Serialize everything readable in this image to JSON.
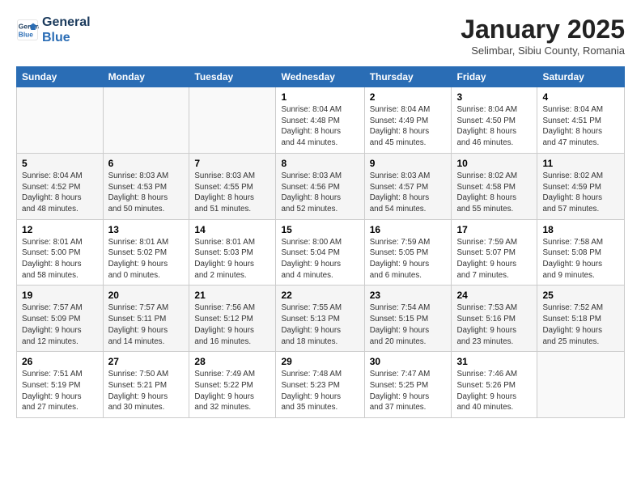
{
  "logo": {
    "line1": "General",
    "line2": "Blue"
  },
  "title": "January 2025",
  "subtitle": "Selimbar, Sibiu County, Romania",
  "headers": [
    "Sunday",
    "Monday",
    "Tuesday",
    "Wednesday",
    "Thursday",
    "Friday",
    "Saturday"
  ],
  "weeks": [
    [
      {
        "num": "",
        "info": ""
      },
      {
        "num": "",
        "info": ""
      },
      {
        "num": "",
        "info": ""
      },
      {
        "num": "1",
        "info": "Sunrise: 8:04 AM\nSunset: 4:48 PM\nDaylight: 8 hours\nand 44 minutes."
      },
      {
        "num": "2",
        "info": "Sunrise: 8:04 AM\nSunset: 4:49 PM\nDaylight: 8 hours\nand 45 minutes."
      },
      {
        "num": "3",
        "info": "Sunrise: 8:04 AM\nSunset: 4:50 PM\nDaylight: 8 hours\nand 46 minutes."
      },
      {
        "num": "4",
        "info": "Sunrise: 8:04 AM\nSunset: 4:51 PM\nDaylight: 8 hours\nand 47 minutes."
      }
    ],
    [
      {
        "num": "5",
        "info": "Sunrise: 8:04 AM\nSunset: 4:52 PM\nDaylight: 8 hours\nand 48 minutes."
      },
      {
        "num": "6",
        "info": "Sunrise: 8:03 AM\nSunset: 4:53 PM\nDaylight: 8 hours\nand 50 minutes."
      },
      {
        "num": "7",
        "info": "Sunrise: 8:03 AM\nSunset: 4:55 PM\nDaylight: 8 hours\nand 51 minutes."
      },
      {
        "num": "8",
        "info": "Sunrise: 8:03 AM\nSunset: 4:56 PM\nDaylight: 8 hours\nand 52 minutes."
      },
      {
        "num": "9",
        "info": "Sunrise: 8:03 AM\nSunset: 4:57 PM\nDaylight: 8 hours\nand 54 minutes."
      },
      {
        "num": "10",
        "info": "Sunrise: 8:02 AM\nSunset: 4:58 PM\nDaylight: 8 hours\nand 55 minutes."
      },
      {
        "num": "11",
        "info": "Sunrise: 8:02 AM\nSunset: 4:59 PM\nDaylight: 8 hours\nand 57 minutes."
      }
    ],
    [
      {
        "num": "12",
        "info": "Sunrise: 8:01 AM\nSunset: 5:00 PM\nDaylight: 8 hours\nand 58 minutes."
      },
      {
        "num": "13",
        "info": "Sunrise: 8:01 AM\nSunset: 5:02 PM\nDaylight: 9 hours\nand 0 minutes."
      },
      {
        "num": "14",
        "info": "Sunrise: 8:01 AM\nSunset: 5:03 PM\nDaylight: 9 hours\nand 2 minutes."
      },
      {
        "num": "15",
        "info": "Sunrise: 8:00 AM\nSunset: 5:04 PM\nDaylight: 9 hours\nand 4 minutes."
      },
      {
        "num": "16",
        "info": "Sunrise: 7:59 AM\nSunset: 5:05 PM\nDaylight: 9 hours\nand 6 minutes."
      },
      {
        "num": "17",
        "info": "Sunrise: 7:59 AM\nSunset: 5:07 PM\nDaylight: 9 hours\nand 7 minutes."
      },
      {
        "num": "18",
        "info": "Sunrise: 7:58 AM\nSunset: 5:08 PM\nDaylight: 9 hours\nand 9 minutes."
      }
    ],
    [
      {
        "num": "19",
        "info": "Sunrise: 7:57 AM\nSunset: 5:09 PM\nDaylight: 9 hours\nand 12 minutes."
      },
      {
        "num": "20",
        "info": "Sunrise: 7:57 AM\nSunset: 5:11 PM\nDaylight: 9 hours\nand 14 minutes."
      },
      {
        "num": "21",
        "info": "Sunrise: 7:56 AM\nSunset: 5:12 PM\nDaylight: 9 hours\nand 16 minutes."
      },
      {
        "num": "22",
        "info": "Sunrise: 7:55 AM\nSunset: 5:13 PM\nDaylight: 9 hours\nand 18 minutes."
      },
      {
        "num": "23",
        "info": "Sunrise: 7:54 AM\nSunset: 5:15 PM\nDaylight: 9 hours\nand 20 minutes."
      },
      {
        "num": "24",
        "info": "Sunrise: 7:53 AM\nSunset: 5:16 PM\nDaylight: 9 hours\nand 23 minutes."
      },
      {
        "num": "25",
        "info": "Sunrise: 7:52 AM\nSunset: 5:18 PM\nDaylight: 9 hours\nand 25 minutes."
      }
    ],
    [
      {
        "num": "26",
        "info": "Sunrise: 7:51 AM\nSunset: 5:19 PM\nDaylight: 9 hours\nand 27 minutes."
      },
      {
        "num": "27",
        "info": "Sunrise: 7:50 AM\nSunset: 5:21 PM\nDaylight: 9 hours\nand 30 minutes."
      },
      {
        "num": "28",
        "info": "Sunrise: 7:49 AM\nSunset: 5:22 PM\nDaylight: 9 hours\nand 32 minutes."
      },
      {
        "num": "29",
        "info": "Sunrise: 7:48 AM\nSunset: 5:23 PM\nDaylight: 9 hours\nand 35 minutes."
      },
      {
        "num": "30",
        "info": "Sunrise: 7:47 AM\nSunset: 5:25 PM\nDaylight: 9 hours\nand 37 minutes."
      },
      {
        "num": "31",
        "info": "Sunrise: 7:46 AM\nSunset: 5:26 PM\nDaylight: 9 hours\nand 40 minutes."
      },
      {
        "num": "",
        "info": ""
      }
    ]
  ]
}
